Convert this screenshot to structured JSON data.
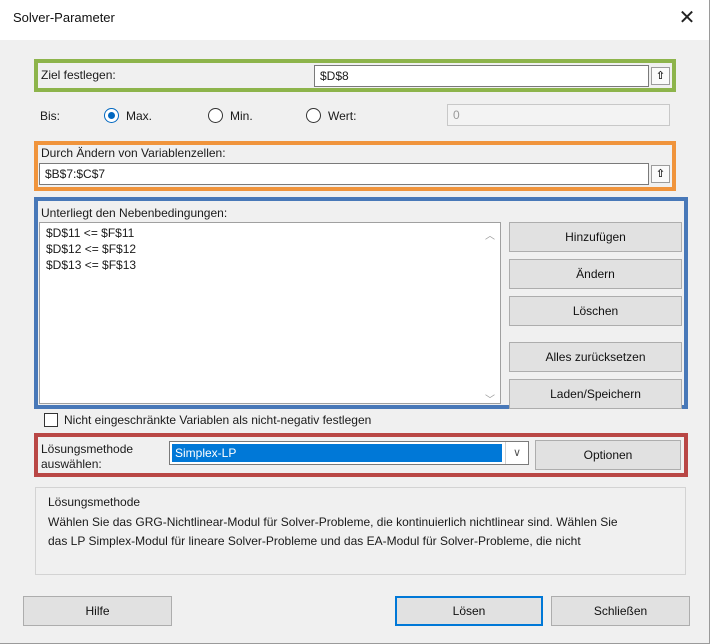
{
  "window": {
    "title": "Solver-Parameter",
    "close_symbol": "✕"
  },
  "objective": {
    "label": "Ziel festlegen:",
    "value": "$D$8",
    "ref_button": "⇧"
  },
  "to": {
    "label": "Bis:",
    "options": [
      {
        "label": "Max.",
        "selected": true
      },
      {
        "label": "Min.",
        "selected": false
      },
      {
        "label": "Wert:",
        "selected": false
      }
    ],
    "value": "0"
  },
  "variables": {
    "label": "Durch Ändern von Variablenzellen:",
    "value": "$B$7:$C$7",
    "ref_button": "⇧"
  },
  "constraints": {
    "label": "Unterliegt den Nebenbedingungen:",
    "items": [
      "$D$11 <= $F$11",
      "$D$12 <= $F$12",
      "$D$13 <= $F$13"
    ],
    "buttons": {
      "add": "Hinzufügen",
      "change": "Ändern",
      "delete": "Löschen",
      "reset_all": "Alles zurücksetzen",
      "load_save": "Laden/Speichern"
    }
  },
  "nonneg": {
    "label": "Nicht eingeschränkte Variablen als nicht-negativ festlegen",
    "checked": false
  },
  "method": {
    "label_line1": "Lösungsmethode",
    "label_line2": "auswählen:",
    "selected": "Simplex-LP",
    "options_button": "Optionen"
  },
  "description": {
    "title": "Lösungsmethode",
    "line1": "Wählen Sie das GRG-Nichtlinear-Modul für Solver-Probleme, die kontinuierlich nichtlinear sind. Wählen Sie",
    "line2": "das LP Simplex-Modul für lineare Solver-Probleme und das EA-Modul für Solver-Probleme, die nicht"
  },
  "footer": {
    "help": "Hilfe",
    "solve": "Lösen",
    "close": "Schließen"
  },
  "colors": {
    "accent": "#0078d7",
    "green": "#8db44b",
    "orange": "#f0943c",
    "blue": "#4878b8",
    "red": "#b94745"
  }
}
